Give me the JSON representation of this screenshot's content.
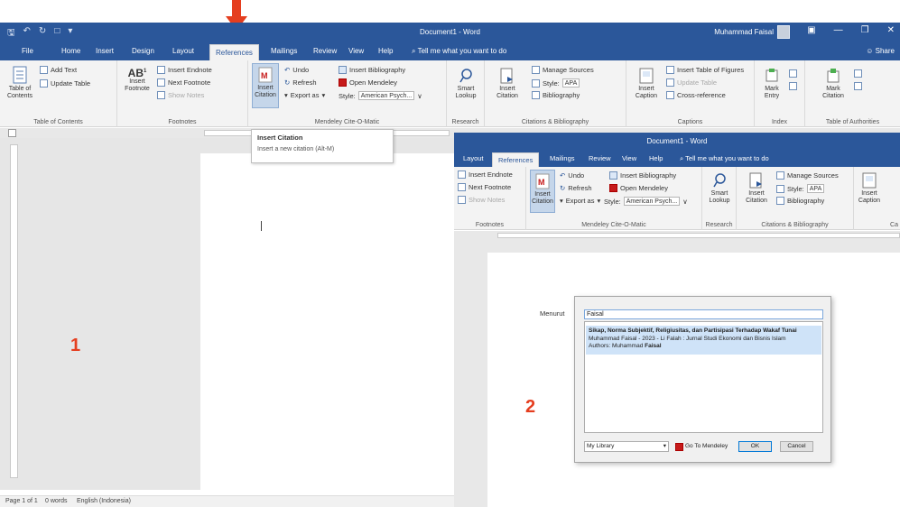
{
  "window1": {
    "title": "Document1 - Word",
    "user": "Muhammad Faisal",
    "share": "Share",
    "tabs": [
      "File",
      "Home",
      "Insert",
      "Design",
      "Layout",
      "References",
      "Mailings",
      "Review",
      "View",
      "Help"
    ],
    "active_tab": "References",
    "tell_me": "Tell me what you want to do",
    "ribbon": {
      "toc": {
        "table_of_contents": "Table of Contents",
        "add_text": "Add Text",
        "update_table": "Update Table",
        "group": "Table of Contents"
      },
      "footnotes": {
        "insert_footnote": "Insert Footnote",
        "insert_endnote": "Insert Endnote",
        "next_footnote": "Next Footnote",
        "show_notes": "Show Notes",
        "group": "Footnotes"
      },
      "mendeley": {
        "insert_citation": "Insert Citation",
        "undo": "Undo",
        "refresh": "Refresh",
        "export_as": "Export as",
        "insert_bibliography": "Insert Bibliography",
        "open_mendeley": "Open Mendeley",
        "style_label": "Style:",
        "style_value": "American Psych...",
        "group": "Mendeley Cite-O-Matic"
      },
      "research": {
        "smart_lookup": "Smart Lookup",
        "group": "Research"
      },
      "citations": {
        "insert_citation": "Insert Citation",
        "manage_sources": "Manage Sources",
        "style_label": "Style:",
        "style_value": "APA",
        "bibliography": "Bibliography",
        "group": "Citations & Bibliography"
      },
      "captions": {
        "insert_caption": "Insert Caption",
        "insert_table_of_figures": "Insert Table of Figures",
        "update_table": "Update Table",
        "cross_reference": "Cross-reference",
        "group": "Captions"
      },
      "index": {
        "mark_entry": "Mark Entry",
        "group": "Index"
      },
      "authorities": {
        "mark_citation": "Mark Citation",
        "group": "Table of Authorities"
      }
    },
    "tooltip": {
      "title": "Insert Citation",
      "description": "Insert a new citation (Alt-M)"
    },
    "status": {
      "page": "Page 1 of 1",
      "words": "0 words",
      "language": "English (Indonesia)"
    },
    "label_number": "1"
  },
  "window2": {
    "title": "Document1 - Word",
    "tabs": [
      "Layout",
      "References",
      "Mailings",
      "Review",
      "View",
      "Help"
    ],
    "active_tab": "References",
    "tell_me": "Tell me what you want to do",
    "ribbon": {
      "footnotes": {
        "insert_endnote": "Insert Endnote",
        "next_footnote": "Next Footnote",
        "show_notes": "Show Notes",
        "group": "Footnotes"
      },
      "mendeley": {
        "insert_citation": "Insert Citation",
        "undo": "Undo",
        "refresh": "Refresh",
        "export_as": "Export as",
        "insert_bibliography": "Insert Bibliography",
        "open_mendeley": "Open Mendeley",
        "style_label": "Style:",
        "style_value": "American Psych...",
        "group": "Mendeley Cite-O-Matic"
      },
      "research": {
        "smart_lookup": "Smart Lookup",
        "group": "Research"
      },
      "citations": {
        "insert_citation": "Insert Citation",
        "manage_sources": "Manage Sources",
        "style_label": "Style:",
        "style_value": "APA",
        "bibliography": "Bibliography",
        "group": "Citations & Bibliography"
      },
      "captions": {
        "insert_caption": "Insert Caption",
        "group": "Ca"
      }
    },
    "document_text": "Menurut",
    "dialog": {
      "search_value": "Faisal",
      "result": {
        "title": "Sikap, Norma Subjektif, Religiusitas, dan Partisipasi Terhadap Wakaf Tunai",
        "meta": "Muhammad Faisal - 2023 - Li Falah : Jurnal Studi Ekonomi dan Bisnis Islam",
        "authors_label": "Authors: Muhammad",
        "authors_bold": "Faisal"
      },
      "library": "My Library",
      "go_to_mendeley": "Go To Mendeley",
      "ok": "OK",
      "cancel": "Cancel"
    },
    "label_number": "2"
  },
  "colors": {
    "word_blue": "#2b579a",
    "annotation_red": "#e53e1f",
    "ribbon_bg": "#f3f3f3",
    "selection": "#cfe3f8"
  },
  "icons": [
    "save-icon",
    "undo-icon",
    "redo-icon",
    "search-icon",
    "mendeley-icon",
    "red-arrow-icon"
  ]
}
